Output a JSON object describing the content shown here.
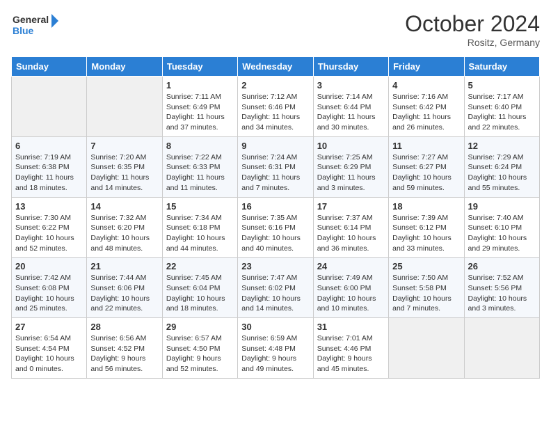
{
  "header": {
    "logo_line1": "General",
    "logo_line2": "Blue",
    "month": "October 2024",
    "location": "Rositz, Germany"
  },
  "weekdays": [
    "Sunday",
    "Monday",
    "Tuesday",
    "Wednesday",
    "Thursday",
    "Friday",
    "Saturday"
  ],
  "weeks": [
    [
      {
        "day": "",
        "empty": true
      },
      {
        "day": "",
        "empty": true
      },
      {
        "day": "1",
        "sunrise": "Sunrise: 7:11 AM",
        "sunset": "Sunset: 6:49 PM",
        "daylight": "Daylight: 11 hours and 37 minutes."
      },
      {
        "day": "2",
        "sunrise": "Sunrise: 7:12 AM",
        "sunset": "Sunset: 6:46 PM",
        "daylight": "Daylight: 11 hours and 34 minutes."
      },
      {
        "day": "3",
        "sunrise": "Sunrise: 7:14 AM",
        "sunset": "Sunset: 6:44 PM",
        "daylight": "Daylight: 11 hours and 30 minutes."
      },
      {
        "day": "4",
        "sunrise": "Sunrise: 7:16 AM",
        "sunset": "Sunset: 6:42 PM",
        "daylight": "Daylight: 11 hours and 26 minutes."
      },
      {
        "day": "5",
        "sunrise": "Sunrise: 7:17 AM",
        "sunset": "Sunset: 6:40 PM",
        "daylight": "Daylight: 11 hours and 22 minutes."
      }
    ],
    [
      {
        "day": "6",
        "sunrise": "Sunrise: 7:19 AM",
        "sunset": "Sunset: 6:38 PM",
        "daylight": "Daylight: 11 hours and 18 minutes."
      },
      {
        "day": "7",
        "sunrise": "Sunrise: 7:20 AM",
        "sunset": "Sunset: 6:35 PM",
        "daylight": "Daylight: 11 hours and 14 minutes."
      },
      {
        "day": "8",
        "sunrise": "Sunrise: 7:22 AM",
        "sunset": "Sunset: 6:33 PM",
        "daylight": "Daylight: 11 hours and 11 minutes."
      },
      {
        "day": "9",
        "sunrise": "Sunrise: 7:24 AM",
        "sunset": "Sunset: 6:31 PM",
        "daylight": "Daylight: 11 hours and 7 minutes."
      },
      {
        "day": "10",
        "sunrise": "Sunrise: 7:25 AM",
        "sunset": "Sunset: 6:29 PM",
        "daylight": "Daylight: 11 hours and 3 minutes."
      },
      {
        "day": "11",
        "sunrise": "Sunrise: 7:27 AM",
        "sunset": "Sunset: 6:27 PM",
        "daylight": "Daylight: 10 hours and 59 minutes."
      },
      {
        "day": "12",
        "sunrise": "Sunrise: 7:29 AM",
        "sunset": "Sunset: 6:24 PM",
        "daylight": "Daylight: 10 hours and 55 minutes."
      }
    ],
    [
      {
        "day": "13",
        "sunrise": "Sunrise: 7:30 AM",
        "sunset": "Sunset: 6:22 PM",
        "daylight": "Daylight: 10 hours and 52 minutes."
      },
      {
        "day": "14",
        "sunrise": "Sunrise: 7:32 AM",
        "sunset": "Sunset: 6:20 PM",
        "daylight": "Daylight: 10 hours and 48 minutes."
      },
      {
        "day": "15",
        "sunrise": "Sunrise: 7:34 AM",
        "sunset": "Sunset: 6:18 PM",
        "daylight": "Daylight: 10 hours and 44 minutes."
      },
      {
        "day": "16",
        "sunrise": "Sunrise: 7:35 AM",
        "sunset": "Sunset: 6:16 PM",
        "daylight": "Daylight: 10 hours and 40 minutes."
      },
      {
        "day": "17",
        "sunrise": "Sunrise: 7:37 AM",
        "sunset": "Sunset: 6:14 PM",
        "daylight": "Daylight: 10 hours and 36 minutes."
      },
      {
        "day": "18",
        "sunrise": "Sunrise: 7:39 AM",
        "sunset": "Sunset: 6:12 PM",
        "daylight": "Daylight: 10 hours and 33 minutes."
      },
      {
        "day": "19",
        "sunrise": "Sunrise: 7:40 AM",
        "sunset": "Sunset: 6:10 PM",
        "daylight": "Daylight: 10 hours and 29 minutes."
      }
    ],
    [
      {
        "day": "20",
        "sunrise": "Sunrise: 7:42 AM",
        "sunset": "Sunset: 6:08 PM",
        "daylight": "Daylight: 10 hours and 25 minutes."
      },
      {
        "day": "21",
        "sunrise": "Sunrise: 7:44 AM",
        "sunset": "Sunset: 6:06 PM",
        "daylight": "Daylight: 10 hours and 22 minutes."
      },
      {
        "day": "22",
        "sunrise": "Sunrise: 7:45 AM",
        "sunset": "Sunset: 6:04 PM",
        "daylight": "Daylight: 10 hours and 18 minutes."
      },
      {
        "day": "23",
        "sunrise": "Sunrise: 7:47 AM",
        "sunset": "Sunset: 6:02 PM",
        "daylight": "Daylight: 10 hours and 14 minutes."
      },
      {
        "day": "24",
        "sunrise": "Sunrise: 7:49 AM",
        "sunset": "Sunset: 6:00 PM",
        "daylight": "Daylight: 10 hours and 10 minutes."
      },
      {
        "day": "25",
        "sunrise": "Sunrise: 7:50 AM",
        "sunset": "Sunset: 5:58 PM",
        "daylight": "Daylight: 10 hours and 7 minutes."
      },
      {
        "day": "26",
        "sunrise": "Sunrise: 7:52 AM",
        "sunset": "Sunset: 5:56 PM",
        "daylight": "Daylight: 10 hours and 3 minutes."
      }
    ],
    [
      {
        "day": "27",
        "sunrise": "Sunrise: 6:54 AM",
        "sunset": "Sunset: 4:54 PM",
        "daylight": "Daylight: 10 hours and 0 minutes."
      },
      {
        "day": "28",
        "sunrise": "Sunrise: 6:56 AM",
        "sunset": "Sunset: 4:52 PM",
        "daylight": "Daylight: 9 hours and 56 minutes."
      },
      {
        "day": "29",
        "sunrise": "Sunrise: 6:57 AM",
        "sunset": "Sunset: 4:50 PM",
        "daylight": "Daylight: 9 hours and 52 minutes."
      },
      {
        "day": "30",
        "sunrise": "Sunrise: 6:59 AM",
        "sunset": "Sunset: 4:48 PM",
        "daylight": "Daylight: 9 hours and 49 minutes."
      },
      {
        "day": "31",
        "sunrise": "Sunrise: 7:01 AM",
        "sunset": "Sunset: 4:46 PM",
        "daylight": "Daylight: 9 hours and 45 minutes."
      },
      {
        "day": "",
        "empty": true
      },
      {
        "day": "",
        "empty": true
      }
    ]
  ]
}
